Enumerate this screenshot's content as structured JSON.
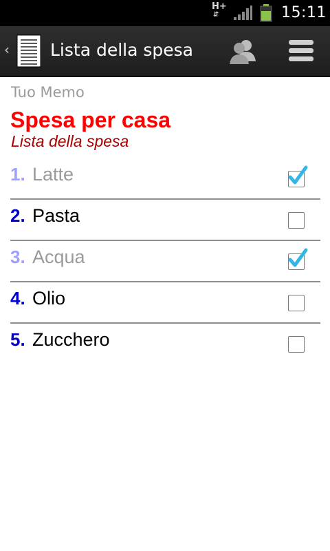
{
  "status_bar": {
    "network": "H+",
    "time": "15:11"
  },
  "action_bar": {
    "title": "Lista della spesa",
    "icons": [
      "back-chevron-icon",
      "document-icon",
      "contacts-icon",
      "menu-icon"
    ]
  },
  "memo": {
    "label": "Tuo Memo",
    "title": "Spesa per casa",
    "subtitle": "Lista della spesa"
  },
  "items": [
    {
      "number": "1.",
      "label": "Latte",
      "checked": true
    },
    {
      "number": "2.",
      "label": "Pasta",
      "checked": false
    },
    {
      "number": "3.",
      "label": "Acqua",
      "checked": true
    },
    {
      "number": "4.",
      "label": "Olio",
      "checked": false
    },
    {
      "number": "5.",
      "label": "Zucchero",
      "checked": false
    }
  ],
  "colors": {
    "title": "#ff0000",
    "subtitle": "#aa0000",
    "number": "#0000cc",
    "number_done": "#9ea0ff",
    "check": "#33b5e5"
  }
}
